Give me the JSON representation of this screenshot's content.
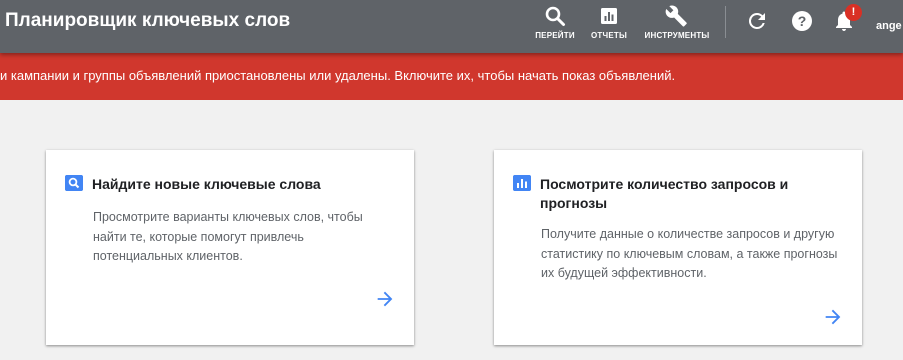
{
  "header": {
    "title": "Планировщик ключевых слов",
    "nav": [
      {
        "label": "ПЕРЕЙТИ",
        "icon": "search-icon"
      },
      {
        "label": "ОТЧЕТЫ",
        "icon": "reports-icon"
      },
      {
        "label": "ИНСТРУМЕНТЫ",
        "icon": "wrench-icon"
      }
    ],
    "notification_count": "!",
    "user": "ange"
  },
  "alert": {
    "text": "и кампании и группы объявлений приостановлены или удалены. Включите их, чтобы начать показ объявлений."
  },
  "cards": [
    {
      "icon": "search-icon",
      "title": "Найдите новые ключевые слова",
      "description": "Просмотрите варианты ключевых слов, чтобы найти те, которые помогут привлечь потенциальных клиентов."
    },
    {
      "icon": "bar-chart-icon",
      "title": "Посмотрите количество запросов и прогнозы",
      "description": "Получите данные о количестве запросов и другую статистику по ключевым словам, а также прогнозы их будущей эффективности."
    }
  ],
  "colors": {
    "header_bg": "#5f6368",
    "alert_bg": "#d0372d",
    "accent": "#4285f4",
    "page_bg": "#f1f1f1"
  }
}
